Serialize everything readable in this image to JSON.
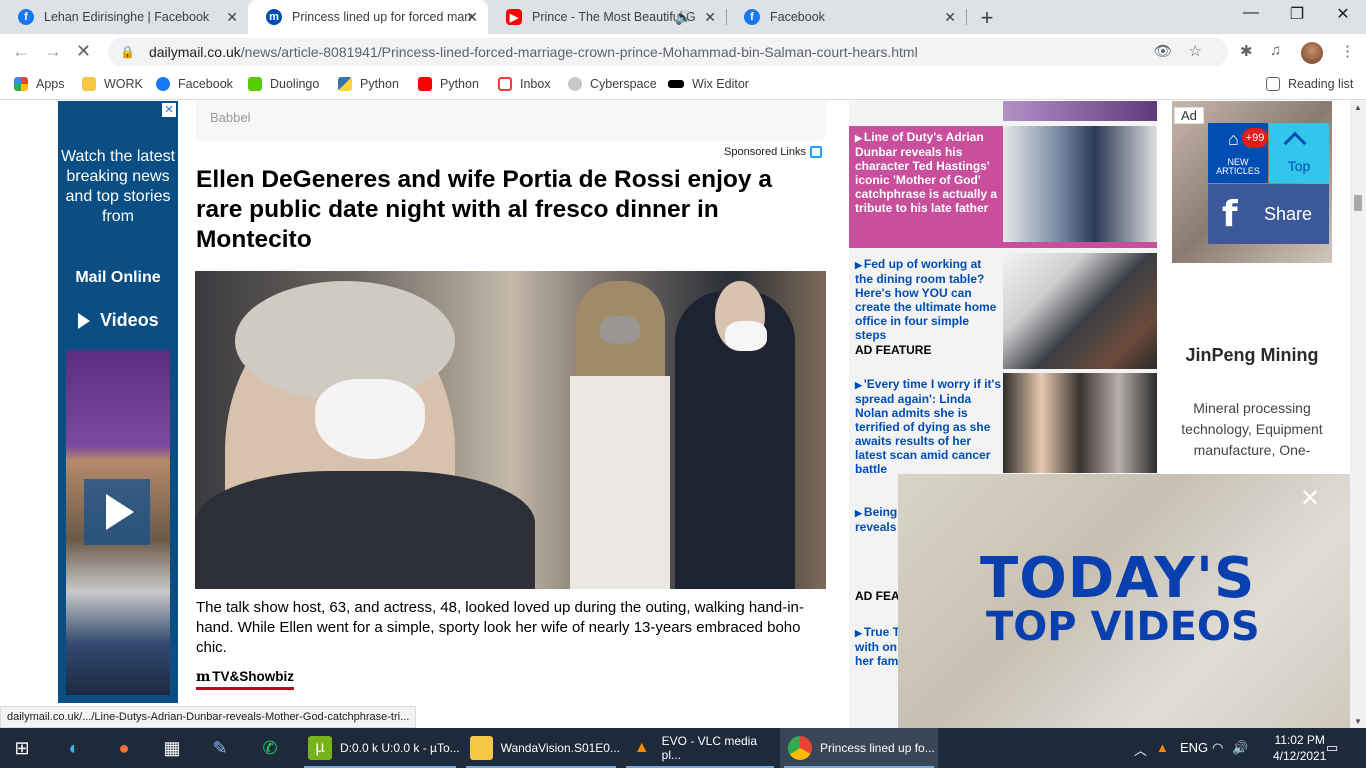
{
  "browser": {
    "tabs": [
      {
        "title": "Lehan Edirisinghe | Facebook",
        "icon": "facebook-icon",
        "color": "#1877f2"
      },
      {
        "title": "Princess lined up for forced marr",
        "icon": "dailymail-icon",
        "color": "#004db3"
      },
      {
        "title": "Prince - The Most Beautiful G",
        "icon": "youtube-icon",
        "color": "#ff0000"
      },
      {
        "title": "Facebook",
        "icon": "facebook-icon",
        "color": "#1877f2"
      }
    ],
    "url_host": "dailymail.co.uk",
    "url_path": "/news/article-8081941/Princess-lined-forced-marriage-crown-prince-Mohammad-bin-Salman-court-hears.html",
    "reading_list": "Reading list",
    "bookmarks": [
      {
        "label": "Apps",
        "icon": "apps-grid-icon",
        "color": "#ea4335"
      },
      {
        "label": "WORK",
        "icon": "folder-icon",
        "color": "#f6c744"
      },
      {
        "label": "Facebook",
        "icon": "facebook-icon",
        "color": "#1877f2"
      },
      {
        "label": "Duolingo",
        "icon": "duolingo-icon",
        "color": "#58cc02"
      },
      {
        "label": "Python",
        "icon": "python-icon",
        "color": "#3776ab"
      },
      {
        "label": "Python",
        "icon": "youtube-icon",
        "color": "#ff0000"
      },
      {
        "label": "Inbox",
        "icon": "gmail-icon",
        "color": "#ea4335"
      },
      {
        "label": "Cyberspace",
        "icon": "cyberspace-icon",
        "color": "#8a8a8a"
      },
      {
        "label": "Wix Editor",
        "icon": "wix-icon",
        "color": "#000000"
      }
    ]
  },
  "page": {
    "sponsored_source": "Babbel",
    "sponsored_links": "Sponsored Links",
    "headline": "Ellen DeGeneres and wife Portia de Rossi enjoy a rare public date night with al fresco dinner in Montecito",
    "caption": "The talk show host, 63, and actress, 48, looked loved up during the outing, walking hand-in-hand. While Ellen went for a simple, sporty look her wife of nearly 13-years embraced boho chic.",
    "channel": "TV&Showbiz",
    "left_ad": {
      "watch": "Watch the latest breaking news and top stories from",
      "brand": "Mail Online",
      "videos": "Videos"
    },
    "news": [
      {
        "text": "Line of Duty's Adrian Dunbar reveals his character Ted Hastings' iconic 'Mother of God' catchphrase is actually a tribute to his late father",
        "tag": ""
      },
      {
        "text": "Fed up of working at the dining room table? Here's how YOU can create the ultimate home office in four simple steps",
        "tag": "AD FEATURE"
      },
      {
        "text": "'Every time I worry if it's spread again': Linda Nolan admits she is terrified of dying as she awaits results of her latest scan amid cancer battle",
        "tag": ""
      },
      {
        "text": "Being it's a kn hopeful reveals run a su busines",
        "tag": "AD FEA"
      },
      {
        "text": "True T three! K Kardasl with on Tristan receive her fam",
        "tag": ""
      }
    ],
    "right_ad": {
      "label": "Ad",
      "company": "JinPeng Mining",
      "desc": "Mineral processing technology, Equipment manufacture, One-"
    },
    "social": {
      "badge": "+99",
      "new_articles": "NEW ARTICLES",
      "top": "Top",
      "share": "Share"
    },
    "video_overlay": {
      "line1": "TODAY'S",
      "line2": "TOP VIDEOS"
    },
    "status_url": "dailymail.co.uk/.../Line-Dutys-Adrian-Dunbar-reveals-Mother-God-catchphrase-tri..."
  },
  "taskbar": {
    "items": [
      {
        "label": "D:0.0 k U:0.0 k - µTo...",
        "icon": "utorrent-icon",
        "color": "#78b31c"
      },
      {
        "label": "WandaVision.S01E0...",
        "icon": "folder-icon",
        "color": "#f6c744"
      },
      {
        "label": "EVO - VLC media pl...",
        "icon": "vlc-icon",
        "color": "#f08a00"
      },
      {
        "label": "Princess lined up fo...",
        "icon": "chrome-icon",
        "color": "#4285f4"
      }
    ],
    "time": "11:02 PM",
    "date": "4/12/2021"
  }
}
